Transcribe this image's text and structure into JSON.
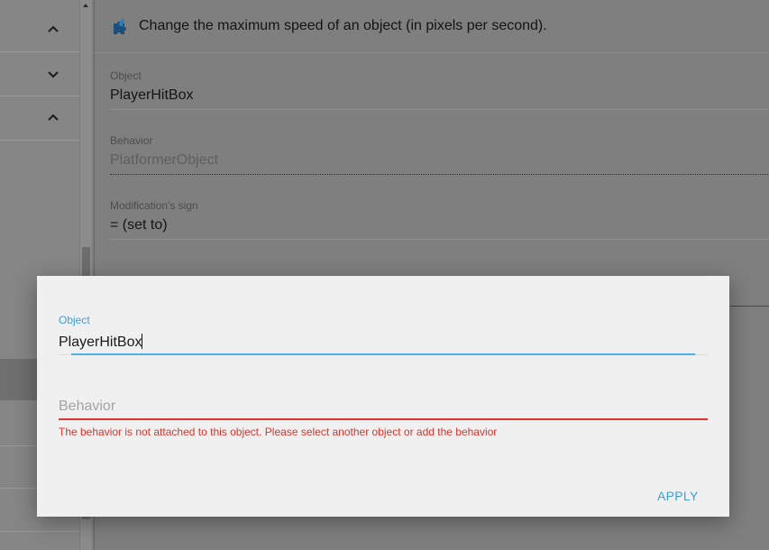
{
  "background": {
    "header_text": "Change the maximum speed of an object (in pixels per second).",
    "header_icon": "puzzle-icon",
    "fields": [
      {
        "label": "Object",
        "value": "PlayerHitBox"
      },
      {
        "label": "Behavior",
        "value": "PlatformerObject"
      },
      {
        "label": "Modification's sign",
        "value": "= (set to)"
      }
    ],
    "left_chevrons": [
      "chevron-up-icon",
      "chevron-down-icon",
      "chevron-up-icon"
    ]
  },
  "dialog": {
    "object_label": "Object",
    "object_value": "PlayerHitBox",
    "behavior_placeholder": "Behavior",
    "error_text": "The behavior is not attached to this object. Please select another object or add the behavior",
    "apply_label": "APPLY"
  },
  "colors": {
    "accent": "#3aa0dd",
    "error": "#e0322a",
    "overlay": "#7c7c7c",
    "dialog_bg": "#f0f0f0"
  }
}
